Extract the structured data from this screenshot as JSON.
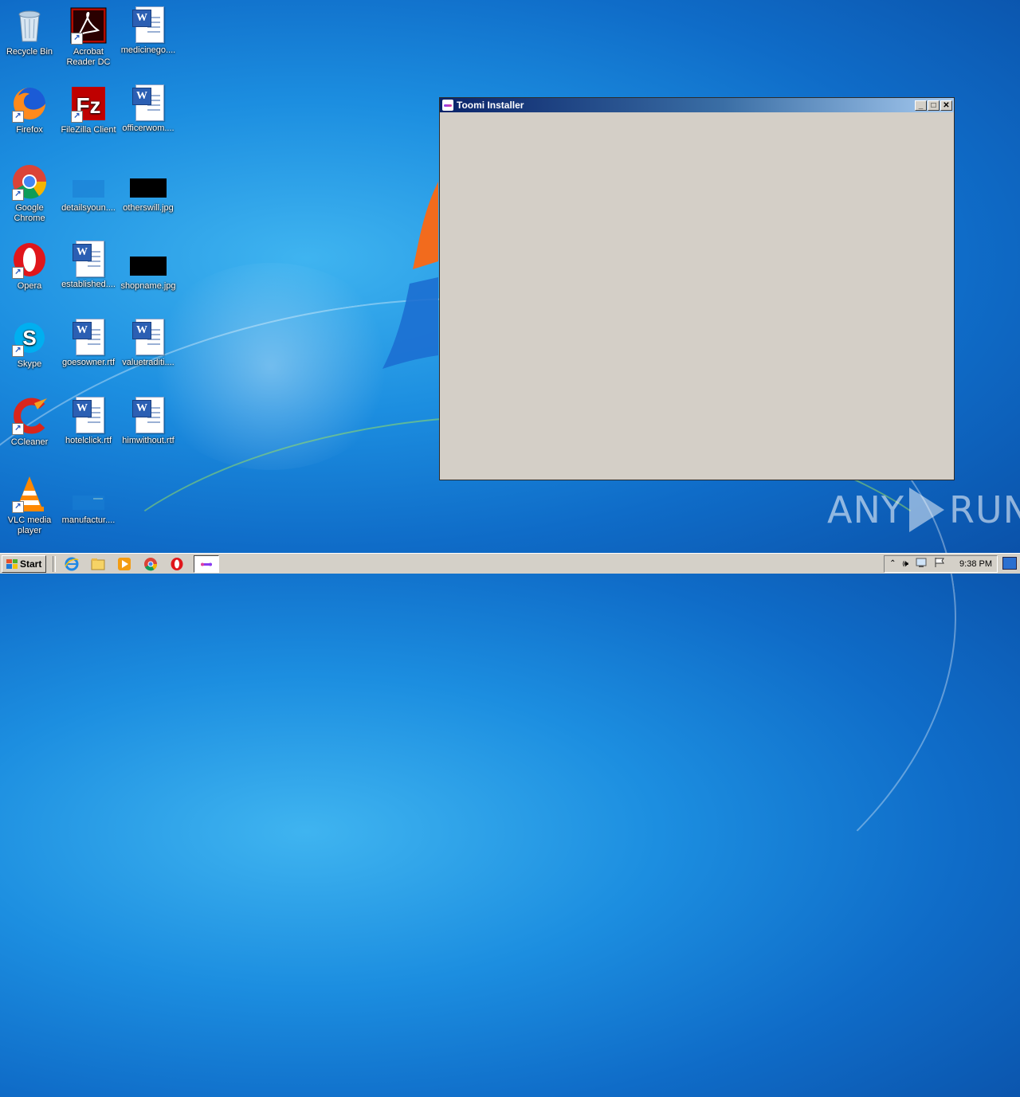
{
  "desktop": {
    "icons": [
      {
        "label": "Recycle Bin",
        "icon": "recycle-bin-icon"
      },
      {
        "label": "Acrobat Reader DC",
        "icon": "acrobat-reader-icon"
      },
      {
        "label": "medicinego....",
        "icon": "word-document-icon"
      },
      {
        "label": "Firefox",
        "icon": "firefox-icon"
      },
      {
        "label": "FileZilla Client",
        "icon": "filezilla-icon"
      },
      {
        "label": "officerwom....",
        "icon": "word-document-icon"
      },
      {
        "label": "Google Chrome",
        "icon": "chrome-icon"
      },
      {
        "label": "detailsyoun....",
        "icon": "image-file-icon"
      },
      {
        "label": "otherswill.jpg",
        "icon": "image-file-icon"
      },
      {
        "label": "Opera",
        "icon": "opera-icon"
      },
      {
        "label": "established....",
        "icon": "word-document-icon"
      },
      {
        "label": "shopname.jpg",
        "icon": "image-file-icon"
      },
      {
        "label": "Skype",
        "icon": "skype-icon"
      },
      {
        "label": "goesowner.rtf",
        "icon": "word-document-icon"
      },
      {
        "label": "valuetraditi....",
        "icon": "word-document-icon"
      },
      {
        "label": "CCleaner",
        "icon": "ccleaner-icon"
      },
      {
        "label": "hotelclick.rtf",
        "icon": "word-document-icon"
      },
      {
        "label": "himwithout.rtf",
        "icon": "word-document-icon"
      },
      {
        "label": "VLC media player",
        "icon": "vlc-icon"
      },
      {
        "label": "manufactur....",
        "icon": "image-file-icon"
      }
    ]
  },
  "window": {
    "title": "Toomi Installer",
    "min_label": "_",
    "max_label": "□",
    "close_label": "✕"
  },
  "watermark": {
    "left": "ANY",
    "right": "RUN"
  },
  "taskbar": {
    "start_label": "Start",
    "clock": "9:38 PM",
    "apps": [
      "internet-explorer-icon",
      "file-explorer-icon",
      "media-player-icon",
      "chrome-icon",
      "opera-icon",
      "toomi-installer-icon"
    ]
  },
  "colors": {
    "window_bg": "#d4cfc7",
    "titlebar_start": "#0a246a",
    "titlebar_end": "#a6caf0",
    "taskbar": "#d4d0c8"
  }
}
